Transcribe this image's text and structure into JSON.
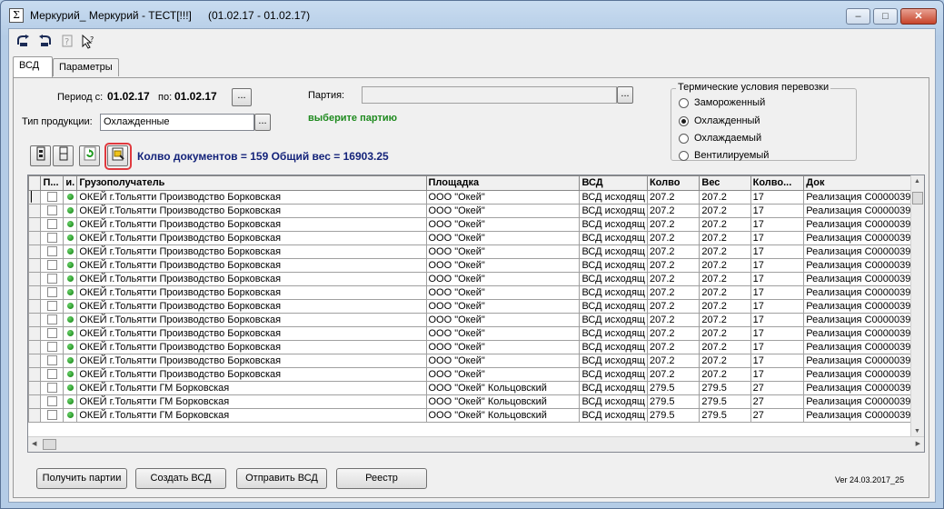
{
  "window": {
    "title": "Меркурий_ Меркурий - ТЕСТ[!!!]",
    "date_range": "(01.02.17 - 01.02.17)",
    "minimize_glyph": "–",
    "maximize_glyph": "□",
    "close_glyph": "✕"
  },
  "toolbar": {
    "icons": [
      "back-icon",
      "forward-icon",
      "help-doc-icon",
      "context-help-icon"
    ]
  },
  "tabs": [
    {
      "label": "ВСД",
      "active": true
    },
    {
      "label": "Параметры",
      "active": false
    }
  ],
  "form": {
    "period_label": "Период с:",
    "period_from": "01.02.17",
    "period_to_label": "по:",
    "period_to": "01.02.17",
    "dots": "...",
    "product_type_label": "Тип продукции:",
    "product_type_value": "Охлажденные",
    "batch_label": "Партия:",
    "batch_value": "",
    "batch_hint": "выберите партию"
  },
  "thermal": {
    "title": "Термические условия перевозки",
    "options": [
      {
        "label": "Замороженный",
        "selected": false
      },
      {
        "label": "Охлажденный",
        "selected": true
      },
      {
        "label": "Охлаждаемый",
        "selected": false
      },
      {
        "label": "Вентилируемый",
        "selected": false
      }
    ]
  },
  "summary": "Колво документов = 159 Общий вес = 16903.25",
  "grid": {
    "columns": [
      "П...",
      "и.",
      "Грузополучатель",
      "Площадка",
      "ВСД",
      "Колво",
      "Вес",
      "Колво...",
      "Док"
    ],
    "rows": [
      [
        "ОКЕЙ г.Тольятти Производство Борковская",
        "ООО \"Окей\"",
        "ВСД исходящ",
        "207.2",
        "207.2",
        "17",
        "Реализация  C0000039"
      ],
      [
        "ОКЕЙ г.Тольятти Производство Борковская",
        "ООО \"Окей\"",
        "ВСД исходящ",
        "207.2",
        "207.2",
        "17",
        "Реализация  C0000039"
      ],
      [
        "ОКЕЙ г.Тольятти Производство Борковская",
        "ООО \"Окей\"",
        "ВСД исходящ",
        "207.2",
        "207.2",
        "17",
        "Реализация  C0000039"
      ],
      [
        "ОКЕЙ г.Тольятти Производство Борковская",
        "ООО \"Окей\"",
        "ВСД исходящ",
        "207.2",
        "207.2",
        "17",
        "Реализация  C0000039"
      ],
      [
        "ОКЕЙ г.Тольятти Производство Борковская",
        "ООО \"Окей\"",
        "ВСД исходящ",
        "207.2",
        "207.2",
        "17",
        "Реализация  C0000039"
      ],
      [
        "ОКЕЙ г.Тольятти Производство Борковская",
        "ООО \"Окей\"",
        "ВСД исходящ",
        "207.2",
        "207.2",
        "17",
        "Реализация  C0000039"
      ],
      [
        "ОКЕЙ г.Тольятти Производство Борковская",
        "ООО \"Окей\"",
        "ВСД исходящ",
        "207.2",
        "207.2",
        "17",
        "Реализация  C0000039"
      ],
      [
        "ОКЕЙ г.Тольятти Производство Борковская",
        "ООО \"Окей\"",
        "ВСД исходящ",
        "207.2",
        "207.2",
        "17",
        "Реализация  C0000039"
      ],
      [
        "ОКЕЙ г.Тольятти Производство Борковская",
        "ООО \"Окей\"",
        "ВСД исходящ",
        "207.2",
        "207.2",
        "17",
        "Реализация  C0000039"
      ],
      [
        "ОКЕЙ г.Тольятти Производство Борковская",
        "ООО \"Окей\"",
        "ВСД исходящ",
        "207.2",
        "207.2",
        "17",
        "Реализация  C0000039"
      ],
      [
        "ОКЕЙ г.Тольятти Производство Борковская",
        "ООО \"Окей\"",
        "ВСД исходящ",
        "207.2",
        "207.2",
        "17",
        "Реализация  C0000039"
      ],
      [
        "ОКЕЙ г.Тольятти Производство Борковская",
        "ООО \"Окей\"",
        "ВСД исходящ",
        "207.2",
        "207.2",
        "17",
        "Реализация  C0000039"
      ],
      [
        "ОКЕЙ г.Тольятти Производство Борковская",
        "ООО \"Окей\"",
        "ВСД исходящ",
        "207.2",
        "207.2",
        "17",
        "Реализация  C0000039"
      ],
      [
        "ОКЕЙ г.Тольятти Производство Борковская",
        "ООО \"Окей\"",
        "ВСД исходящ",
        "207.2",
        "207.2",
        "17",
        "Реализация  C0000039"
      ],
      [
        "ОКЕЙ г.Тольятти  ГМ Борковская",
        "ООО \"Окей\" Кольцовский",
        "ВСД исходящ",
        "279.5",
        "279.5",
        "27",
        "Реализация  C0000039"
      ],
      [
        "ОКЕЙ г.Тольятти  ГМ Борковская",
        "ООО \"Окей\" Кольцовский",
        "ВСД исходящ",
        "279.5",
        "279.5",
        "27",
        "Реализация  C0000039"
      ],
      [
        "ОКЕЙ г.Тольятти  ГМ Борковская",
        "ООО \"Окей\" Кольцовский",
        "ВСД исходящ",
        "279.5",
        "279.5",
        "27",
        "Реализация  C0000039"
      ]
    ]
  },
  "buttons": {
    "get_batches": "Получить партии",
    "create_vsd": "Создать ВСД",
    "send_vsd": "Отправить ВСД",
    "registry": "Реестр"
  },
  "version": "Ver 24.03.2017_25"
}
